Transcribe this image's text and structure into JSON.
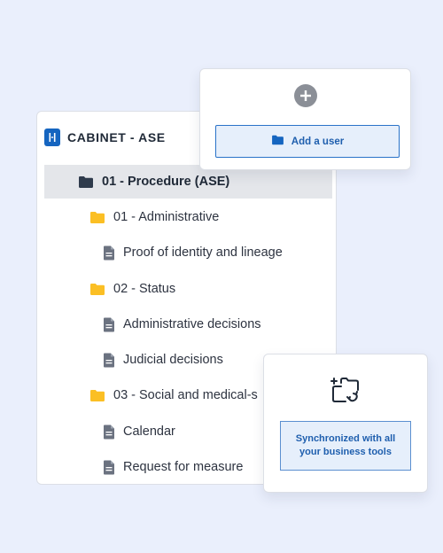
{
  "colors": {
    "background": "#eaeffc",
    "brand_blue": "#1565c0",
    "folder_yellow": "#fbbf24",
    "folder_dark": "#2f3b4c",
    "doc_gray": "#6b7280",
    "accent_border": "#2a73c8"
  },
  "cabinet": {
    "title": "CABINET - ASE",
    "icon": "cabinet-logo-icon",
    "items": [
      {
        "label": "01 - Procedure (ASE)",
        "type": "folder-root",
        "icon": "folder-dark-icon"
      },
      {
        "label": "01 - Administrative",
        "type": "folder",
        "icon": "folder-icon"
      },
      {
        "label": "Proof of identity and lineage",
        "type": "document",
        "icon": "document-icon"
      },
      {
        "label": "02 - Status",
        "type": "folder",
        "icon": "folder-icon"
      },
      {
        "label": "Administrative decisions",
        "type": "document",
        "icon": "document-icon"
      },
      {
        "label": "Judicial decisions",
        "type": "document",
        "icon": "document-icon"
      },
      {
        "label": "03 - Social and medical-s",
        "type": "folder",
        "icon": "folder-icon"
      },
      {
        "label": "Calendar",
        "type": "document",
        "icon": "document-icon"
      },
      {
        "label": "Request for measure",
        "type": "document",
        "icon": "document-icon"
      }
    ]
  },
  "add_card": {
    "icon": "plus-circle-icon",
    "button_label": "Add a user",
    "button_icon": "folder-icon"
  },
  "sync_card": {
    "icon": "folder-sync-icon",
    "badge_text": "Synchronized with all your business tools"
  }
}
